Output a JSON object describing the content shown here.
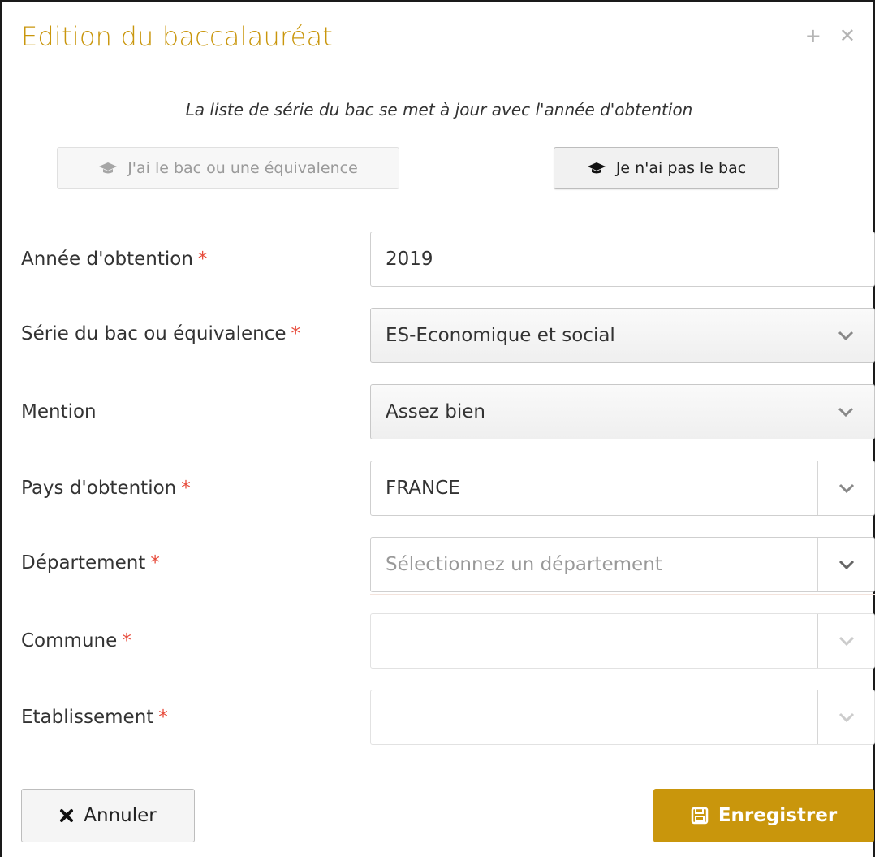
{
  "dialog": {
    "title": "Edition du baccalauréat",
    "add_icon": "plus-icon",
    "close_icon": "close-icon",
    "subtitle": "La liste de série du bac se met à jour avec l'année d'obtention"
  },
  "toggle": {
    "has_bac_label": "J'ai le bac ou une équivalence",
    "no_bac_label": "Je n'ai pas le bac",
    "icon": "graduation-cap-icon"
  },
  "form": {
    "year": {
      "label": "Année d'obtention",
      "required": "*",
      "value": "2019"
    },
    "series": {
      "label": "Série du bac ou équivalence",
      "required": "*",
      "value": "ES-Economique et social"
    },
    "mention": {
      "label": "Mention",
      "value": "Assez bien"
    },
    "country": {
      "label": "Pays d'obtention",
      "required": "*",
      "value": "FRANCE"
    },
    "department": {
      "label": "Département",
      "required": "*",
      "placeholder": "Sélectionnez un département"
    },
    "commune": {
      "label": "Commune",
      "required": "*",
      "value": ""
    },
    "establishment": {
      "label": "Etablissement",
      "required": "*",
      "value": ""
    }
  },
  "footer": {
    "cancel_label": "Annuler",
    "save_label": "Enregistrer"
  },
  "colors": {
    "accent": "#c9960c",
    "required": "#e74c3c"
  }
}
